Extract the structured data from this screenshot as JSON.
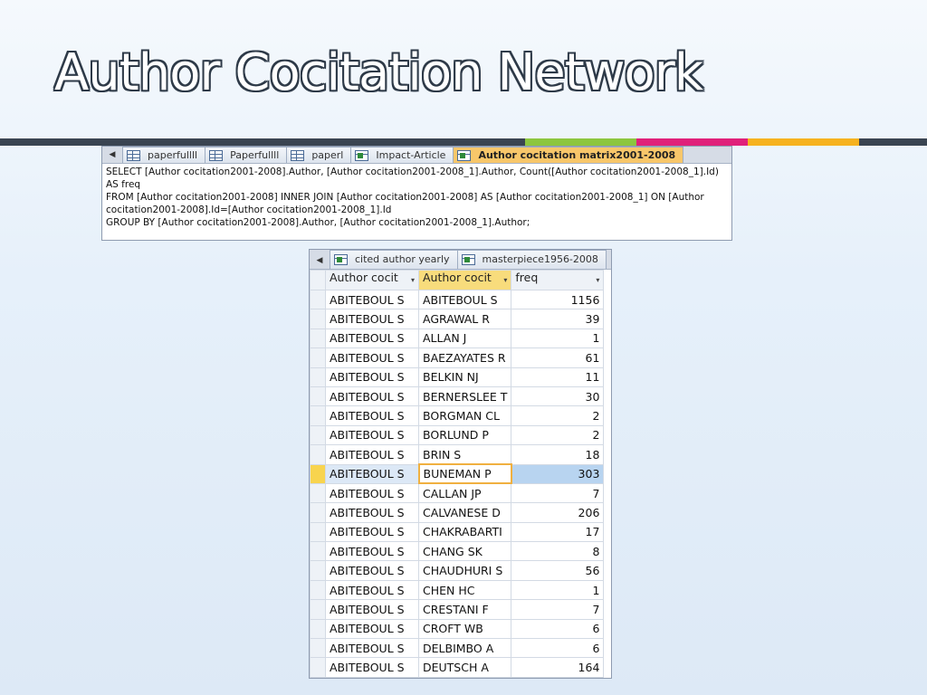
{
  "slide": {
    "title": "Author Cocitation Network",
    "divider_colors": [
      "#3a4451",
      "#8cc63f",
      "#e0207a",
      "#f6b21f",
      "#3a4451"
    ]
  },
  "sql_panel": {
    "tabs": [
      {
        "label": "paperfullll",
        "icon": "table-icon",
        "active": false
      },
      {
        "label": "Paperfullll",
        "icon": "table-icon",
        "active": false
      },
      {
        "label": "paperl",
        "icon": "table-icon",
        "active": false
      },
      {
        "label": "Impact-Article",
        "icon": "query-icon",
        "active": false
      },
      {
        "label": "Author cocitation matrix2001-2008",
        "icon": "query-icon",
        "active": true
      }
    ],
    "sql_lines": [
      "SELECT [Author cocitation2001-2008].Author, [Author cocitation2001-2008_1].Author, Count([Author cocitation2001-2008_1].Id)",
      "AS freq",
      "FROM [Author cocitation2001-2008] INNER JOIN [Author cocitation2001-2008] AS [Author cocitation2001-2008_1] ON [Author",
      "cocitation2001-2008].Id=[Author cocitation2001-2008_1].Id",
      "GROUP BY [Author cocitation2001-2008].Author, [Author cocitation2001-2008_1].Author;"
    ]
  },
  "grid_panel": {
    "tabs": [
      {
        "label": "cited author yearly",
        "icon": "query-icon"
      },
      {
        "label": "masterpiece1956-2008",
        "icon": "query-icon"
      }
    ],
    "columns": [
      "Author cocit",
      "Author cocit",
      "freq"
    ],
    "sort_indicator": "▾",
    "selected_row": 9,
    "rows": [
      [
        "ABITEBOUL S",
        "ABITEBOUL S",
        "1156"
      ],
      [
        "ABITEBOUL S",
        "AGRAWAL R",
        "39"
      ],
      [
        "ABITEBOUL S",
        "ALLAN J",
        "1"
      ],
      [
        "ABITEBOUL S",
        "BAEZAYATES R",
        "61"
      ],
      [
        "ABITEBOUL S",
        "BELKIN NJ",
        "11"
      ],
      [
        "ABITEBOUL S",
        "BERNERSLEE T",
        "30"
      ],
      [
        "ABITEBOUL S",
        "BORGMAN CL",
        "2"
      ],
      [
        "ABITEBOUL S",
        "BORLUND P",
        "2"
      ],
      [
        "ABITEBOUL S",
        "BRIN S",
        "18"
      ],
      [
        "ABITEBOUL S",
        "BUNEMAN P",
        "303"
      ],
      [
        "ABITEBOUL S",
        "CALLAN JP",
        "7"
      ],
      [
        "ABITEBOUL S",
        "CALVANESE D",
        "206"
      ],
      [
        "ABITEBOUL S",
        "CHAKRABARTI",
        "17"
      ],
      [
        "ABITEBOUL S",
        "CHANG SK",
        "8"
      ],
      [
        "ABITEBOUL S",
        "CHAUDHURI S",
        "56"
      ],
      [
        "ABITEBOUL S",
        "CHEN HC",
        "1"
      ],
      [
        "ABITEBOUL S",
        "CRESTANI F",
        "7"
      ],
      [
        "ABITEBOUL S",
        "CROFT WB",
        "6"
      ],
      [
        "ABITEBOUL S",
        "DELBIMBO A",
        "6"
      ],
      [
        "ABITEBOUL S",
        "DEUTSCH A",
        "164"
      ]
    ]
  }
}
